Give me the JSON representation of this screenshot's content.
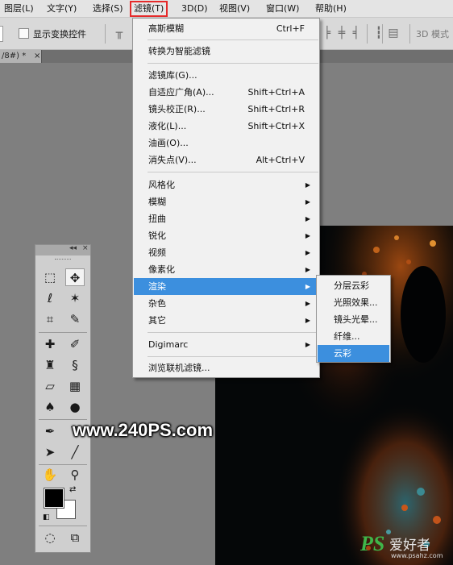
{
  "menubar": {
    "items": [
      {
        "label": "图层(L)"
      },
      {
        "label": "文字(Y)"
      },
      {
        "label": "选择(S)"
      },
      {
        "label": "滤镜(T)",
        "active": true
      },
      {
        "label": "3D(D)"
      },
      {
        "label": "视图(V)"
      },
      {
        "label": "窗口(W)"
      },
      {
        "label": "帮助(H)"
      }
    ]
  },
  "options_bar": {
    "show_transform_label": "显示变换控件",
    "mode_3d_label": "3D 模式"
  },
  "document_tab": {
    "title": "/8#) *",
    "close": "×"
  },
  "filter_menu": {
    "items": [
      {
        "label": "高斯模糊",
        "shortcut": "Ctrl+F"
      },
      {
        "label": "转换为智能滤镜"
      },
      {
        "label": "滤镜库(G)..."
      },
      {
        "label": "自适应广角(A)...",
        "shortcut": "Shift+Ctrl+A"
      },
      {
        "label": "镜头校正(R)...",
        "shortcut": "Shift+Ctrl+R"
      },
      {
        "label": "液化(L)...",
        "shortcut": "Shift+Ctrl+X"
      },
      {
        "label": "油画(O)..."
      },
      {
        "label": "消失点(V)...",
        "shortcut": "Alt+Ctrl+V"
      },
      {
        "label": "风格化",
        "submenu": true
      },
      {
        "label": "模糊",
        "submenu": true
      },
      {
        "label": "扭曲",
        "submenu": true
      },
      {
        "label": "锐化",
        "submenu": true
      },
      {
        "label": "视频",
        "submenu": true
      },
      {
        "label": "像素化",
        "submenu": true
      },
      {
        "label": "渲染",
        "submenu": true,
        "highlighted": true
      },
      {
        "label": "杂色",
        "submenu": true
      },
      {
        "label": "其它",
        "submenu": true
      },
      {
        "label": "Digimarc",
        "submenu": true
      },
      {
        "label": "浏览联机滤镜..."
      }
    ]
  },
  "render_submenu": {
    "items": [
      {
        "label": "分层云彩"
      },
      {
        "label": "光照效果..."
      },
      {
        "label": "镜头光晕..."
      },
      {
        "label": "纤维..."
      },
      {
        "label": "云彩",
        "highlighted": true
      }
    ]
  },
  "tool_panel": {
    "header_controls": [
      "◂◂",
      "×"
    ],
    "foreground_color": "#000000",
    "background_color": "#ffffff"
  },
  "watermark": {
    "url_text": "www.240PS.com",
    "logo_ps": "PS",
    "logo_cn": "爱好者",
    "logo_url": "www.psahz.com"
  },
  "colors": {
    "menu_highlight": "#3c8fde",
    "active_menu_border": "#e52a2a",
    "workspace": "#7f7f7f"
  }
}
